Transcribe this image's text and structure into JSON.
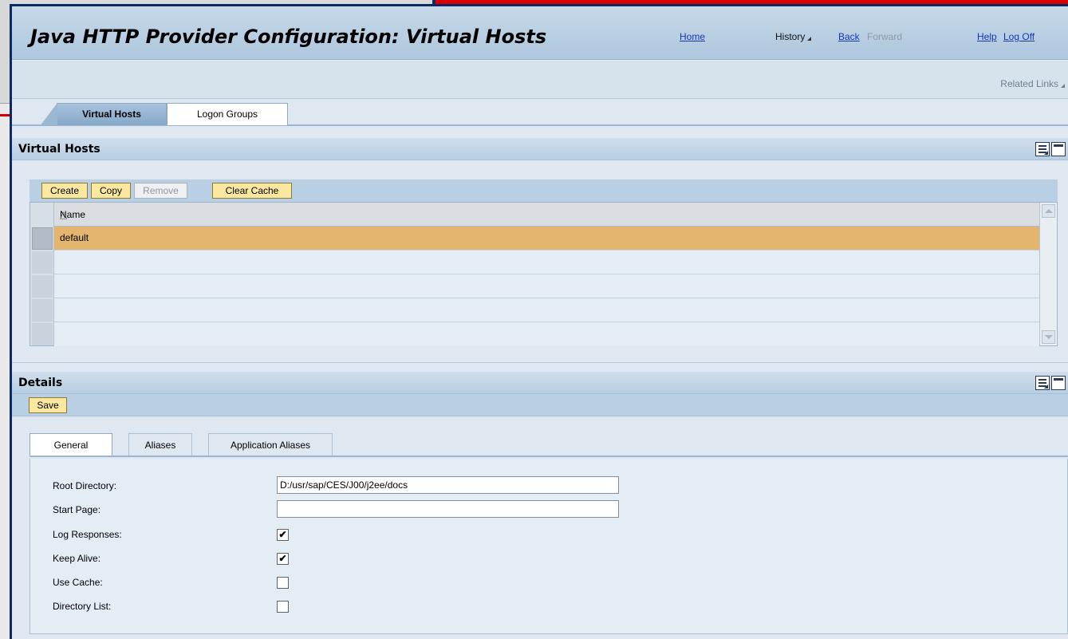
{
  "header": {
    "title": "Java HTTP Provider Configuration: Virtual Hosts",
    "home": "Home",
    "history": "History",
    "back": "Back",
    "forward": "Forward",
    "help": "Help",
    "logoff": "Log Off",
    "related_links": "Related Links"
  },
  "tabs": [
    {
      "label": "Virtual Hosts",
      "active": true
    },
    {
      "label": "Logon Groups",
      "active": false
    }
  ],
  "virtual_hosts": {
    "section_title": "Virtual Hosts",
    "buttons": {
      "create": "Create",
      "copy": "Copy",
      "remove": "Remove",
      "clear_cache": "Clear Cache"
    },
    "table": {
      "column_name": "Name",
      "rows": [
        "default",
        "",
        "",
        "",
        ""
      ]
    }
  },
  "details": {
    "section_title": "Details",
    "save": "Save",
    "subtabs": [
      {
        "label": "General",
        "active": true
      },
      {
        "label": "Aliases",
        "active": false
      },
      {
        "label": "Application Aliases",
        "active": false
      }
    ],
    "fields": {
      "root_directory_label": "Root Directory:",
      "root_directory_value": "D:/usr/sap/CES/J00/j2ee/docs",
      "start_page_label": "Start Page:",
      "start_page_value": "",
      "log_responses_label": "Log Responses:",
      "log_responses_checked": true,
      "keep_alive_label": "Keep Alive:",
      "keep_alive_checked": true,
      "use_cache_label": "Use Cache:",
      "use_cache_checked": false,
      "directory_list_label": "Directory List:",
      "directory_list_checked": false
    }
  },
  "colors": {
    "header_bg": "#aec7dd",
    "button_bg": "#fce7a0",
    "selected_row": "#e3b56f",
    "window_border": "#0d2a64",
    "link": "#1537b8"
  },
  "icons": {
    "personalize": "list-settings-icon",
    "collapse": "minimize-icon"
  }
}
